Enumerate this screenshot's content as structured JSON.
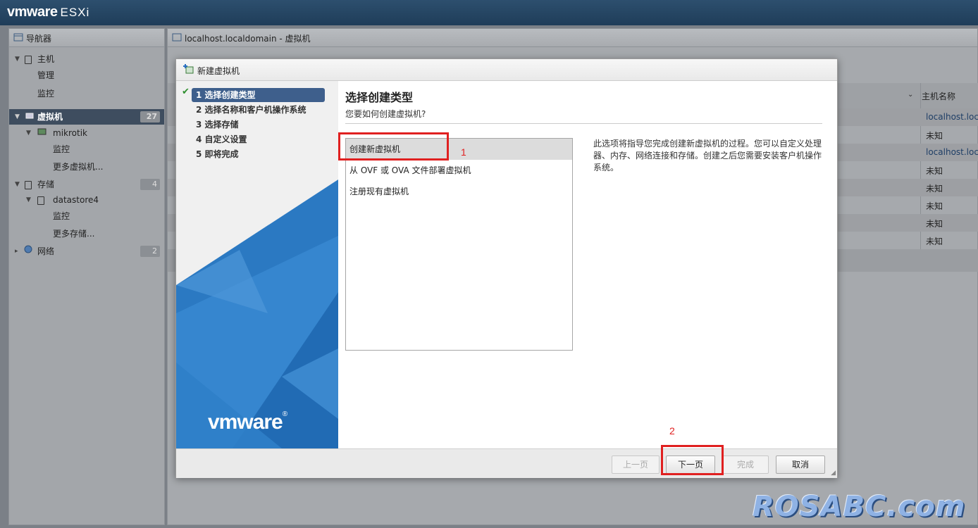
{
  "app": {
    "brand": "vmware",
    "product": "ESXi"
  },
  "navigator": {
    "title": "导航器",
    "items": [
      {
        "label": "主机"
      },
      {
        "label": "管理"
      },
      {
        "label": "监控"
      },
      {
        "label": "虚拟机",
        "count": "27"
      },
      {
        "label": "mikrotik"
      },
      {
        "label": "监控"
      },
      {
        "label": "更多虚拟机..."
      },
      {
        "label": "存储",
        "count": "4"
      },
      {
        "label": "datastore4"
      },
      {
        "label": "监控"
      },
      {
        "label": "更多存储..."
      },
      {
        "label": "网络",
        "count": "2"
      }
    ]
  },
  "main": {
    "title": "localhost.localdomain - 虚拟机",
    "column_header": "主机名称",
    "rows": [
      "localhost.local",
      "未知",
      "localhost.local",
      "未知",
      "未知",
      "未知",
      "未知",
      "未知"
    ]
  },
  "dialog": {
    "title": "新建虚拟机",
    "steps": [
      {
        "label": "1 选择创建类型"
      },
      {
        "label": "2 选择名称和客户机操作系统"
      },
      {
        "label": "3 选择存储"
      },
      {
        "label": "4 自定义设置"
      },
      {
        "label": "5 即将完成"
      }
    ],
    "logo": "vmware",
    "heading": "选择创建类型",
    "subheading": "您要如何创建虚拟机?",
    "options": [
      {
        "label": "创建新虚拟机"
      },
      {
        "label": "从 OVF 或 OVA 文件部署虚拟机"
      },
      {
        "label": "注册现有虚拟机"
      }
    ],
    "description": "此选项将指导您完成创建新虚拟机的过程。您可以自定义处理器、内存、网络连接和存储。创建之后您需要安装客户机操作系统。",
    "buttons": {
      "prev": "上一页",
      "next": "下一页",
      "finish": "完成",
      "cancel": "取消"
    }
  },
  "annotations": {
    "one": "1",
    "two": "2"
  },
  "watermark": "ROSABC.com",
  "colors": {
    "accent_step": "#3e5f8c",
    "annotation_red": "#e02020"
  }
}
